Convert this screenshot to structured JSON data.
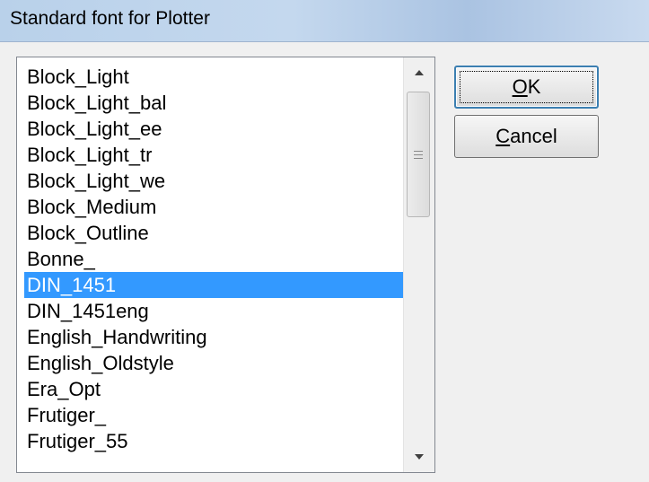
{
  "window": {
    "title": "Standard font for Plotter"
  },
  "font_list": {
    "items": [
      "Block_Light",
      "Block_Light_bal",
      "Block_Light_ee",
      "Block_Light_tr",
      "Block_Light_we",
      "Block_Medium",
      "Block_Outline",
      "Bonne_",
      "DIN_1451",
      "DIN_1451eng",
      "English_Handwriting",
      "English_Oldstyle",
      "Era_Opt",
      "Frutiger_",
      "Frutiger_55"
    ],
    "selected": "DIN_1451",
    "scroll_up_icon": "arrow-up-icon",
    "scroll_down_icon": "arrow-down-icon"
  },
  "buttons": {
    "ok": {
      "label": "OK",
      "accelerator": "O"
    },
    "cancel": {
      "label": "Cancel",
      "accelerator": "C"
    }
  },
  "colors": {
    "selection": "#3399ff",
    "title_bar": "#b9d1ea"
  }
}
